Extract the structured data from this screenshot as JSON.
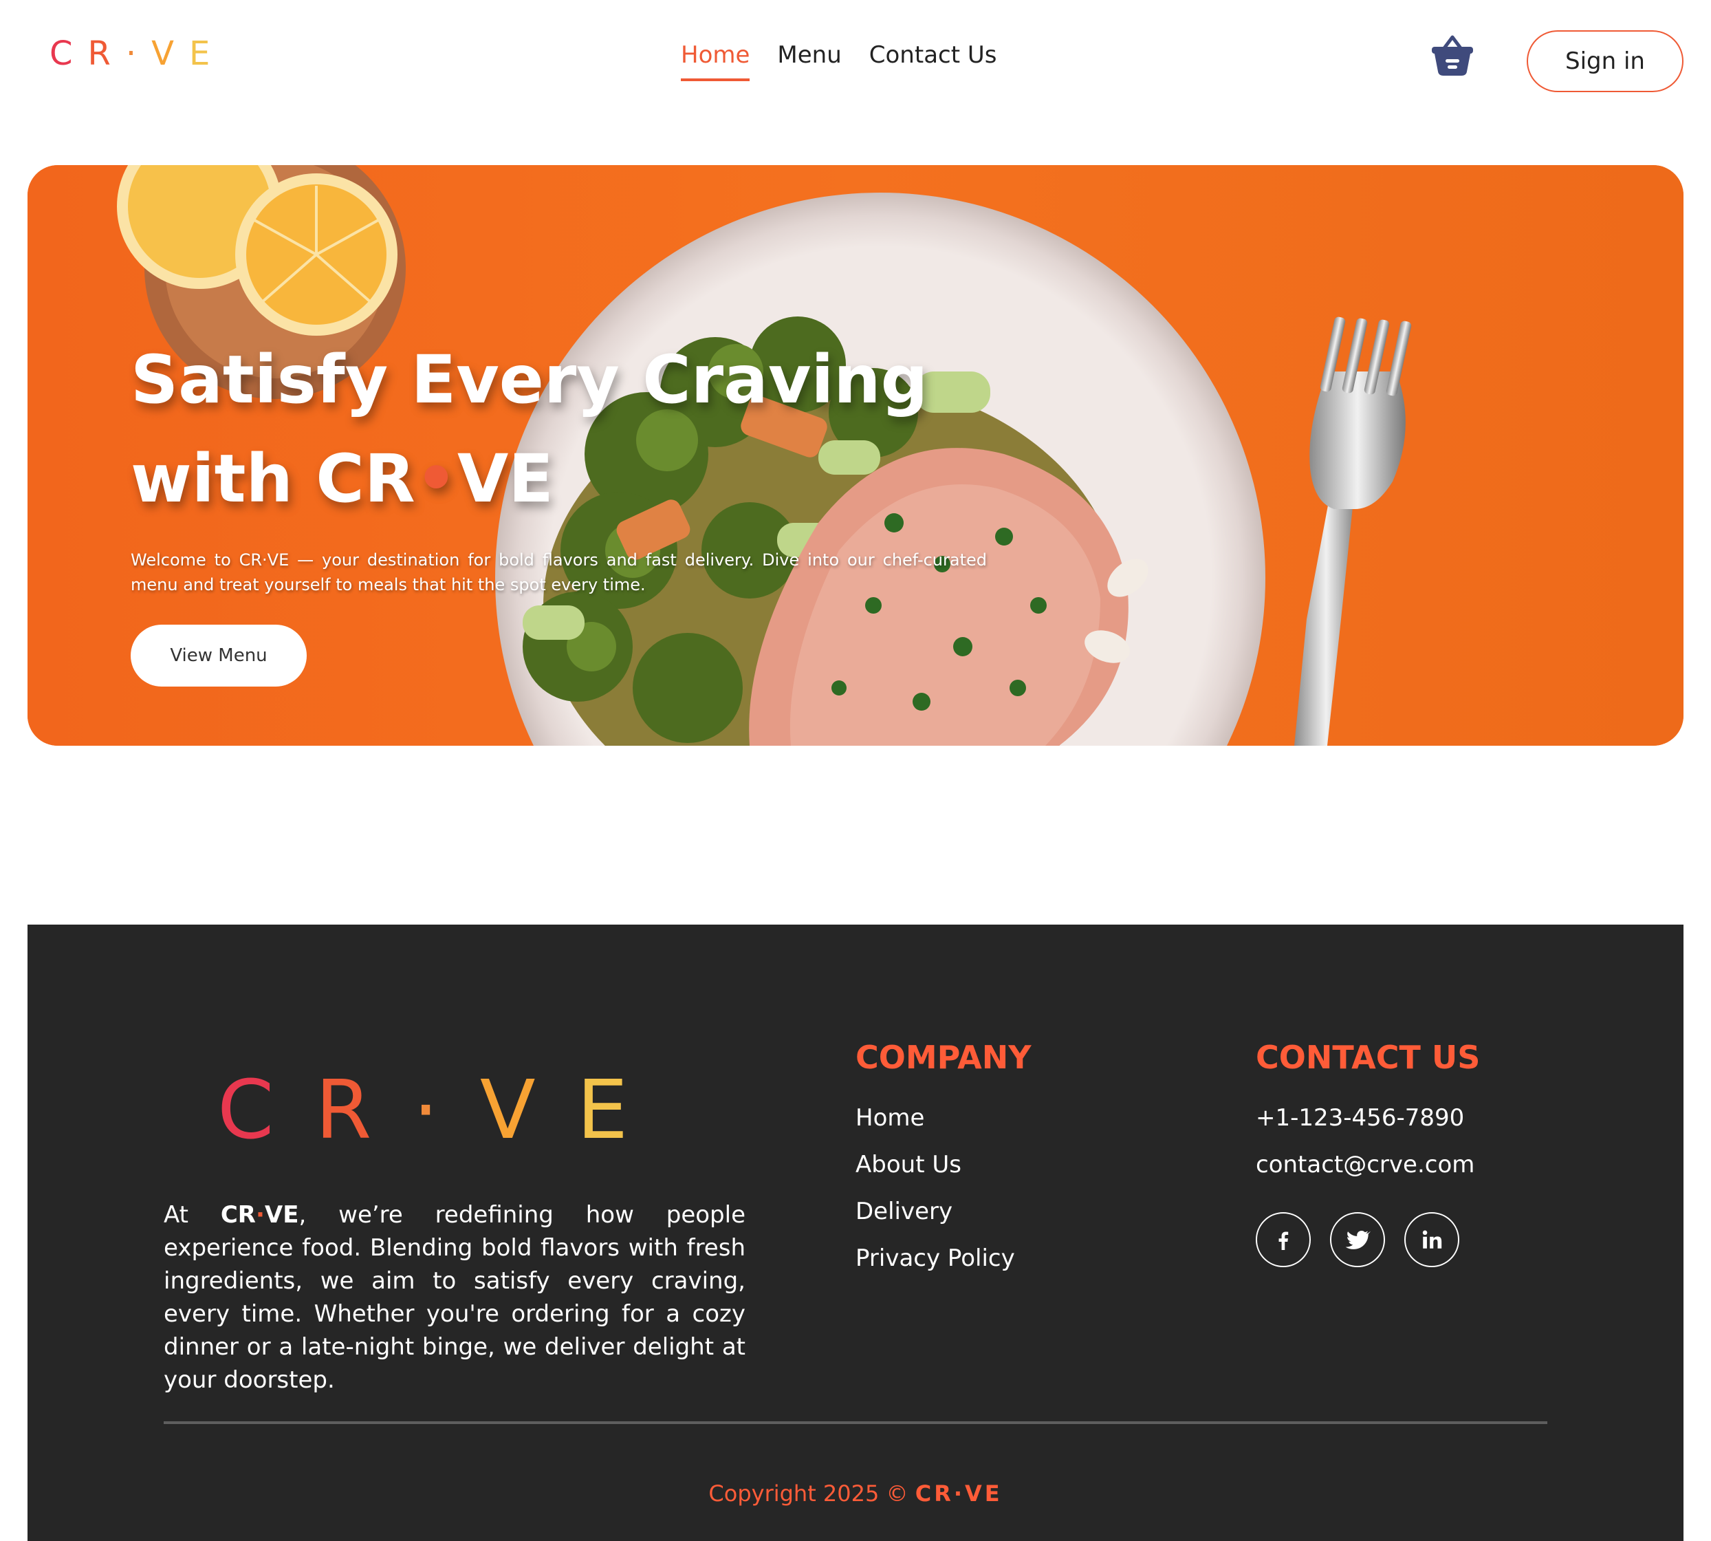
{
  "brand": {
    "letters_left": [
      "C",
      "R"
    ],
    "dot": "·",
    "letters_right": [
      "V",
      "E"
    ],
    "name_text": "CR·VE",
    "name_left": "CR",
    "name_right": "VE",
    "colors": [
      "#e8384f",
      "#ef5a35",
      "#f7a233",
      "#f3c34b"
    ]
  },
  "nav": {
    "items": [
      "Home",
      "Menu",
      "Contact Us"
    ],
    "active": "Home",
    "cart_icon": "shopping-basket-icon",
    "signin_label": "Sign in"
  },
  "hero": {
    "title_line1": "Satisfy Every Craving",
    "title_line2_prefix": "with CR",
    "title_dot": "•",
    "title_line2_suffix": "VE",
    "text": "Welcome to CR·VE — your destination for bold flavors and fast delivery. Dive into our chef-curated menu and treat yourself to meals that hit the spot every time.",
    "button_label": "View Menu",
    "image": "salmon-plate-with-broccoli-lemons-and-fork-on-orange-background"
  },
  "footer": {
    "about_prefix": "At ",
    "about_brand_left": "CR",
    "about_brand_dot": "·",
    "about_brand_right": "VE",
    "about_rest": ", we’re redefining how people experience food. Blending bold flavors with fresh ingredients, we aim to satisfy every craving, every time. Whether you're ordering for a cozy dinner or a late-night binge, we deliver delight at your doorstep.",
    "company": {
      "heading": "COMPANY",
      "links": [
        "Home",
        "About Us",
        "Delivery",
        "Privacy Policy"
      ]
    },
    "contact": {
      "heading": "CONTACT US",
      "phone": "+1-123-456-7890",
      "email": "contact@crve.com",
      "socials": [
        "facebook-icon",
        "twitter-icon",
        "linkedin-icon"
      ]
    },
    "copyright_text": "Copyright 2025 © ",
    "copyright_brand": "CR·VE"
  },
  "colors": {
    "accent": "#ef5a35",
    "hero_bg": "#f4701f",
    "footer_bg": "#262626",
    "footer_heading": "#ff5c38",
    "cart_icon": "#3f4a7c"
  }
}
